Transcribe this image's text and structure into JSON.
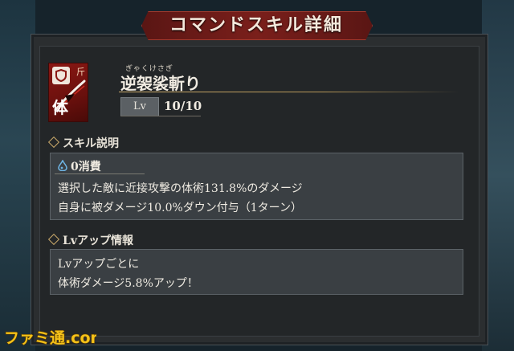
{
  "title": "コマンドスキル詳細",
  "skill": {
    "furigana": "ぎゃくけさぎ",
    "name": "逆袈裟斬り",
    "icon_mark": "斤",
    "icon_type": "体",
    "lv_label": "Lv",
    "lv_value": "10/10"
  },
  "description": {
    "header": "スキル説明",
    "cost": "0消費",
    "lines": [
      "選択した敵に近接攻撃の体術131.8%のダメージ",
      "自身に被ダメージ10.0%ダウン付与（1ターン）"
    ]
  },
  "levelup": {
    "header": "Lvアップ情報",
    "lines": [
      "Lvアップごとに",
      "体術ダメージ5.8%アップ！"
    ]
  },
  "watermark": "ファミ通.com",
  "colors": {
    "banner": "#7a1f1b",
    "accent_gold": "#c9a96a",
    "panel": "#3a3f43"
  }
}
